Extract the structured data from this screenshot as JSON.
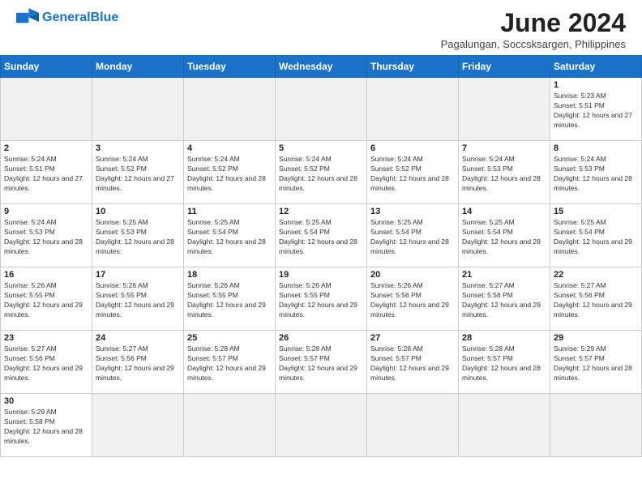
{
  "header": {
    "logo_general": "General",
    "logo_blue": "Blue",
    "month_title": "June 2024",
    "location": "Pagalungan, Soccsksargen, Philippines"
  },
  "weekdays": [
    "Sunday",
    "Monday",
    "Tuesday",
    "Wednesday",
    "Thursday",
    "Friday",
    "Saturday"
  ],
  "days": [
    {
      "day": "",
      "empty": true
    },
    {
      "day": "",
      "empty": true
    },
    {
      "day": "",
      "empty": true
    },
    {
      "day": "",
      "empty": true
    },
    {
      "day": "",
      "empty": true
    },
    {
      "day": "",
      "empty": true
    },
    {
      "day": "1",
      "sunrise": "Sunrise: 5:23 AM",
      "sunset": "Sunset: 5:51 PM",
      "daylight": "Daylight: 12 hours and 27 minutes."
    },
    {
      "day": "2",
      "sunrise": "Sunrise: 5:24 AM",
      "sunset": "Sunset: 5:51 PM",
      "daylight": "Daylight: 12 hours and 27 minutes."
    },
    {
      "day": "3",
      "sunrise": "Sunrise: 5:24 AM",
      "sunset": "Sunset: 5:52 PM",
      "daylight": "Daylight: 12 hours and 27 minutes."
    },
    {
      "day": "4",
      "sunrise": "Sunrise: 5:24 AM",
      "sunset": "Sunset: 5:52 PM",
      "daylight": "Daylight: 12 hours and 28 minutes."
    },
    {
      "day": "5",
      "sunrise": "Sunrise: 5:24 AM",
      "sunset": "Sunset: 5:52 PM",
      "daylight": "Daylight: 12 hours and 28 minutes."
    },
    {
      "day": "6",
      "sunrise": "Sunrise: 5:24 AM",
      "sunset": "Sunset: 5:52 PM",
      "daylight": "Daylight: 12 hours and 28 minutes."
    },
    {
      "day": "7",
      "sunrise": "Sunrise: 5:24 AM",
      "sunset": "Sunset: 5:53 PM",
      "daylight": "Daylight: 12 hours and 28 minutes."
    },
    {
      "day": "8",
      "sunrise": "Sunrise: 5:24 AM",
      "sunset": "Sunset: 5:53 PM",
      "daylight": "Daylight: 12 hours and 28 minutes."
    },
    {
      "day": "9",
      "sunrise": "Sunrise: 5:24 AM",
      "sunset": "Sunset: 5:53 PM",
      "daylight": "Daylight: 12 hours and 28 minutes."
    },
    {
      "day": "10",
      "sunrise": "Sunrise: 5:25 AM",
      "sunset": "Sunset: 5:53 PM",
      "daylight": "Daylight: 12 hours and 28 minutes."
    },
    {
      "day": "11",
      "sunrise": "Sunrise: 5:25 AM",
      "sunset": "Sunset: 5:54 PM",
      "daylight": "Daylight: 12 hours and 28 minutes."
    },
    {
      "day": "12",
      "sunrise": "Sunrise: 5:25 AM",
      "sunset": "Sunset: 5:54 PM",
      "daylight": "Daylight: 12 hours and 28 minutes."
    },
    {
      "day": "13",
      "sunrise": "Sunrise: 5:25 AM",
      "sunset": "Sunset: 5:54 PM",
      "daylight": "Daylight: 12 hours and 28 minutes."
    },
    {
      "day": "14",
      "sunrise": "Sunrise: 5:25 AM",
      "sunset": "Sunset: 5:54 PM",
      "daylight": "Daylight: 12 hours and 28 minutes."
    },
    {
      "day": "15",
      "sunrise": "Sunrise: 5:25 AM",
      "sunset": "Sunset: 5:54 PM",
      "daylight": "Daylight: 12 hours and 29 minutes."
    },
    {
      "day": "16",
      "sunrise": "Sunrise: 5:26 AM",
      "sunset": "Sunset: 5:55 PM",
      "daylight": "Daylight: 12 hours and 29 minutes."
    },
    {
      "day": "17",
      "sunrise": "Sunrise: 5:26 AM",
      "sunset": "Sunset: 5:55 PM",
      "daylight": "Daylight: 12 hours and 29 minutes."
    },
    {
      "day": "18",
      "sunrise": "Sunrise: 5:26 AM",
      "sunset": "Sunset: 5:55 PM",
      "daylight": "Daylight: 12 hours and 29 minutes."
    },
    {
      "day": "19",
      "sunrise": "Sunrise: 5:26 AM",
      "sunset": "Sunset: 5:55 PM",
      "daylight": "Daylight: 12 hours and 29 minutes."
    },
    {
      "day": "20",
      "sunrise": "Sunrise: 5:26 AM",
      "sunset": "Sunset: 5:56 PM",
      "daylight": "Daylight: 12 hours and 29 minutes."
    },
    {
      "day": "21",
      "sunrise": "Sunrise: 5:27 AM",
      "sunset": "Sunset: 5:56 PM",
      "daylight": "Daylight: 12 hours and 29 minutes."
    },
    {
      "day": "22",
      "sunrise": "Sunrise: 5:27 AM",
      "sunset": "Sunset: 5:56 PM",
      "daylight": "Daylight: 12 hours and 29 minutes."
    },
    {
      "day": "23",
      "sunrise": "Sunrise: 5:27 AM",
      "sunset": "Sunset: 5:56 PM",
      "daylight": "Daylight: 12 hours and 29 minutes."
    },
    {
      "day": "24",
      "sunrise": "Sunrise: 5:27 AM",
      "sunset": "Sunset: 5:56 PM",
      "daylight": "Daylight: 12 hours and 29 minutes."
    },
    {
      "day": "25",
      "sunrise": "Sunrise: 5:28 AM",
      "sunset": "Sunset: 5:57 PM",
      "daylight": "Daylight: 12 hours and 29 minutes."
    },
    {
      "day": "26",
      "sunrise": "Sunrise: 5:28 AM",
      "sunset": "Sunset: 5:57 PM",
      "daylight": "Daylight: 12 hours and 29 minutes."
    },
    {
      "day": "27",
      "sunrise": "Sunrise: 5:28 AM",
      "sunset": "Sunset: 5:57 PM",
      "daylight": "Daylight: 12 hours and 29 minutes."
    },
    {
      "day": "28",
      "sunrise": "Sunrise: 5:28 AM",
      "sunset": "Sunset: 5:57 PM",
      "daylight": "Daylight: 12 hours and 28 minutes."
    },
    {
      "day": "29",
      "sunrise": "Sunrise: 5:29 AM",
      "sunset": "Sunset: 5:57 PM",
      "daylight": "Daylight: 12 hours and 28 minutes."
    },
    {
      "day": "30",
      "sunrise": "Sunrise: 5:29 AM",
      "sunset": "Sunset: 5:58 PM",
      "daylight": "Daylight: 12 hours and 28 minutes."
    },
    {
      "day": "",
      "empty": true
    },
    {
      "day": "",
      "empty": true
    },
    {
      "day": "",
      "empty": true
    },
    {
      "day": "",
      "empty": true
    },
    {
      "day": "",
      "empty": true
    },
    {
      "day": "",
      "empty": true
    }
  ]
}
